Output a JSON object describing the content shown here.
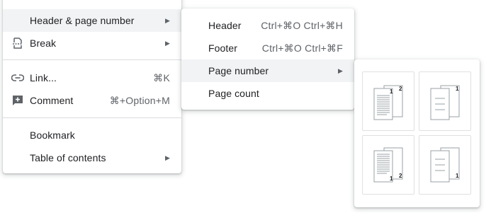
{
  "main_menu": {
    "items": [
      {
        "label": "Header & page number",
        "submenu": true,
        "highlighted": true
      },
      {
        "label": "Break",
        "submenu": true,
        "icon": "page-break-icon"
      },
      {
        "label": "Link...",
        "shortcut": "⌘K",
        "icon": "link-icon"
      },
      {
        "label": "Comment",
        "shortcut": "⌘+Option+M",
        "icon": "add-comment-icon"
      },
      {
        "label": "Bookmark"
      },
      {
        "label": "Table of contents",
        "submenu": true
      }
    ],
    "arrow": "▶"
  },
  "header_submenu": {
    "items": [
      {
        "label": "Header",
        "shortcut": "Ctrl+⌘O Ctrl+⌘H"
      },
      {
        "label": "Footer",
        "shortcut": "Ctrl+⌘O Ctrl+⌘F"
      },
      {
        "label": "Page number",
        "submenu": true,
        "highlighted": true
      },
      {
        "label": "Page count"
      }
    ]
  },
  "page_number_options": [
    {
      "position": "top-right",
      "first_page_numbered": true,
      "numbers": [
        "1",
        "2"
      ]
    },
    {
      "position": "top-right",
      "first_page_numbered": false,
      "numbers": [
        "1"
      ]
    },
    {
      "position": "bottom-right",
      "first_page_numbered": true,
      "numbers": [
        "1",
        "2"
      ]
    },
    {
      "position": "bottom-right",
      "first_page_numbered": false,
      "numbers": [
        "1"
      ]
    }
  ]
}
